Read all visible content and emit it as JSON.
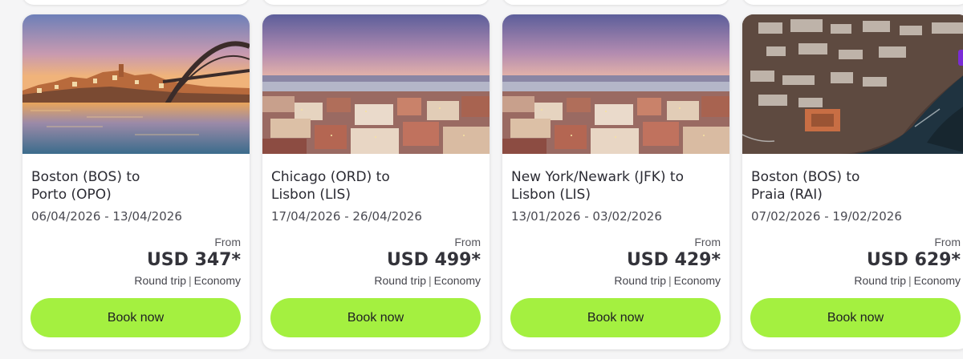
{
  "colors": {
    "button_bg": "#a4f040",
    "card_bg": "#ffffff",
    "page_bg": "#f5f5f6",
    "accent": "#7a2bd6"
  },
  "cards": [
    {
      "image": "porto-bridge-riverside-photo",
      "route_line1": "Boston (BOS) to",
      "route_line2": "Porto (OPO)",
      "dates": "06/04/2026 - 13/04/2026",
      "from_label": "From",
      "price": "USD 347*",
      "trip_type": "Round trip",
      "cabin": "Economy",
      "button_label": "Book now"
    },
    {
      "image": "lisbon-skyline-photo",
      "route_line1": "Chicago (ORD) to",
      "route_line2": "Lisbon (LIS)",
      "dates": "17/04/2026 - 26/04/2026",
      "from_label": "From",
      "price": "USD 499*",
      "trip_type": "Round trip",
      "cabin": "Economy",
      "button_label": "Book now"
    },
    {
      "image": "lisbon-skyline-photo",
      "route_line1": "New York/Newark (JFK) to",
      "route_line2": "Lisbon (LIS)",
      "dates": "13/01/2026 - 03/02/2026",
      "from_label": "From",
      "price": "USD 429*",
      "trip_type": "Round trip",
      "cabin": "Economy",
      "button_label": "Book now"
    },
    {
      "image": "praia-aerial-coast-photo",
      "route_line1": "Boston (BOS) to",
      "route_line2": "Praia (RAI)",
      "dates": "07/02/2026 - 19/02/2026",
      "from_label": "From",
      "price": "USD 629*",
      "trip_type": "Round trip",
      "cabin": "Economy",
      "button_label": "Book now"
    }
  ]
}
